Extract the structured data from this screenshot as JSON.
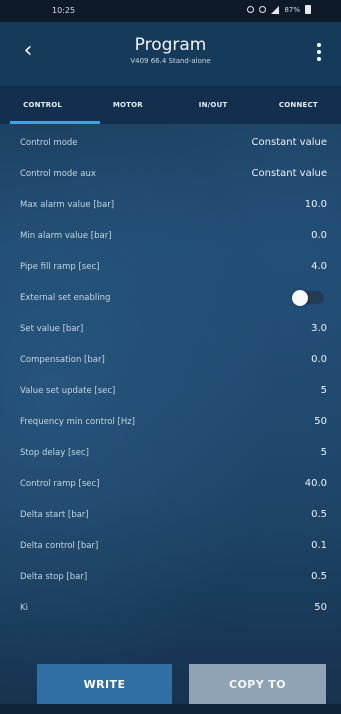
{
  "status_bar": {
    "time": "10:25",
    "battery": "87%"
  },
  "header": {
    "title": "Program",
    "subtitle": "V409 66.4 Stand-alone",
    "back_icon": "chevron-left-icon",
    "menu_icon": "more-vert-icon"
  },
  "tabs": [
    {
      "label": "CONTROL",
      "active": true
    },
    {
      "label": "MOTOR",
      "active": false
    },
    {
      "label": "IN/OUT",
      "active": false
    },
    {
      "label": "CONNECT",
      "active": false
    }
  ],
  "settings": [
    {
      "label": "Control mode",
      "value": "Constant value"
    },
    {
      "label": "Control mode aux",
      "value": "Constant value"
    },
    {
      "label": "Max alarm value [bar]",
      "value": "10.0"
    },
    {
      "label": "Min alarm value [bar]",
      "value": "0.0"
    },
    {
      "label": "Pipe fill ramp [sec]",
      "value": "4.0"
    },
    {
      "label": "External set enabling",
      "value": "",
      "toggle": true,
      "toggle_on": false
    },
    {
      "label": "Set value [bar]",
      "value": "3.0"
    },
    {
      "label": "Compensation [bar]",
      "value": "0.0"
    },
    {
      "label": "Value set update [sec]",
      "value": "5"
    },
    {
      "label": "Frequency min control [Hz]",
      "value": "50"
    },
    {
      "label": "Stop delay [sec]",
      "value": "5"
    },
    {
      "label": "Control ramp [sec]",
      "value": "40.0"
    },
    {
      "label": "Delta start [bar]",
      "value": "0.5"
    },
    {
      "label": "Delta control [bar]",
      "value": "0.1"
    },
    {
      "label": "Delta stop [bar]",
      "value": "0.5"
    },
    {
      "label": "Ki",
      "value": "50"
    }
  ],
  "buttons": {
    "write": "WRITE",
    "copy": "COPY TO"
  },
  "colors": {
    "accent": "#38a6e6",
    "write_button": "#2f6fa4",
    "copy_button": "#8fa3b4"
  }
}
